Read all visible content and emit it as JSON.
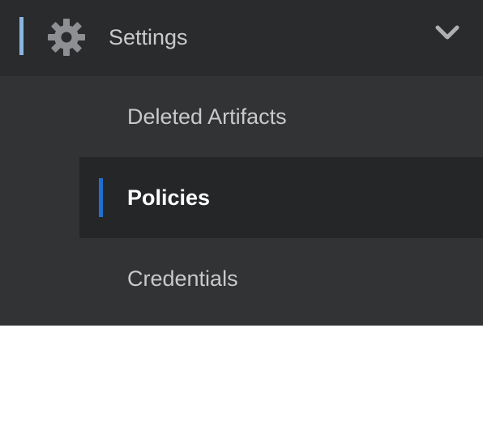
{
  "nav": {
    "header": {
      "label": "Settings",
      "icon": "gear-icon",
      "toggle_icon": "chevron-down-icon",
      "expanded": true
    },
    "items": [
      {
        "label": "Deleted Artifacts",
        "active": false
      },
      {
        "label": "Policies",
        "active": true
      },
      {
        "label": "Credentials",
        "active": false
      }
    ]
  },
  "colors": {
    "nav_background": "#323335",
    "header_background": "#2a2b2d",
    "active_background": "#252628",
    "header_accent": "#8ab6e0",
    "active_accent": "#1f6fd1",
    "text": "#c8c9cb",
    "active_text": "#ffffff"
  }
}
